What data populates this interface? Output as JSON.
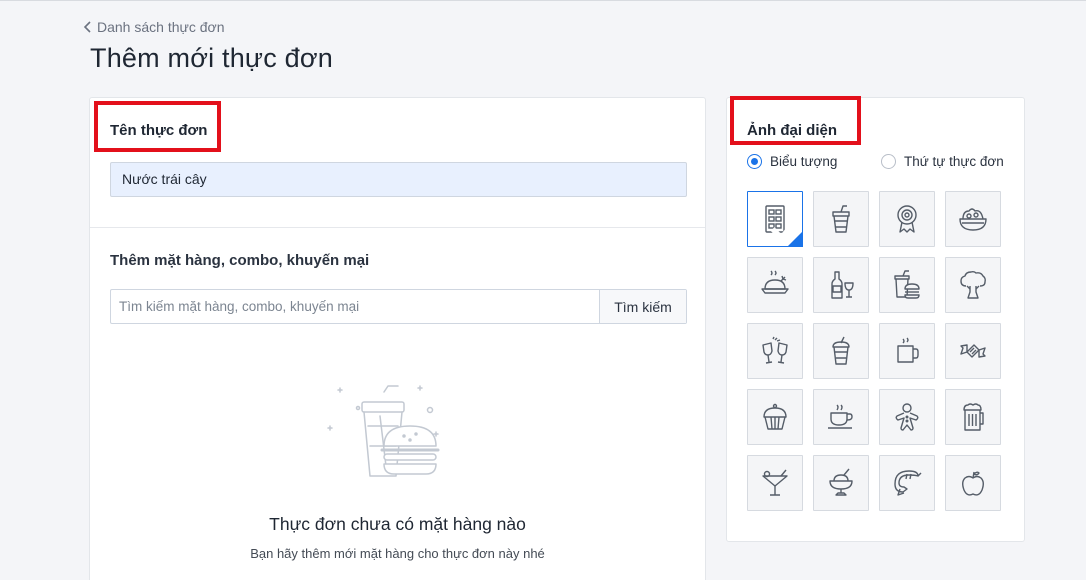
{
  "header": {
    "breadcrumb": "Danh sách thực đơn",
    "title": "Thêm mới thực đơn"
  },
  "menu_name": {
    "label": "Tên thực đơn",
    "value": "Nước trái cây"
  },
  "items": {
    "label": "Thêm mặt hàng, combo, khuyến mại",
    "search_placeholder": "Tìm kiếm mặt hàng, combo, khuyến mại",
    "search_button": "Tìm kiếm",
    "empty_title": "Thực đơn chưa có mặt hàng nào",
    "empty_subtitle": "Bạn hãy thêm mới mặt hàng cho thực đơn này nhé"
  },
  "avatar": {
    "label": "Ảnh đại diện",
    "options": [
      {
        "label": "Biểu tượng",
        "checked": true
      },
      {
        "label": "Thứ tự thực đơn",
        "checked": false
      }
    ],
    "icons": [
      "menu-grid-icon",
      "drink-cup-icon",
      "medal-icon",
      "salad-bowl-icon",
      "roast-chicken-icon",
      "wine-bottle-glass-icon",
      "fast-food-icon",
      "broccoli-icon",
      "toast-glasses-icon",
      "juice-cup-icon",
      "coffee-mug-icon",
      "candy-icon",
      "cupcake-icon",
      "tea-cup-icon",
      "gingerbread-icon",
      "beer-mug-icon",
      "cocktail-icon",
      "ice-cream-bowl-icon",
      "shrimp-icon",
      "apple-icon"
    ],
    "selected_icon": "menu-grid-icon"
  },
  "colors": {
    "accent": "#1a73e8",
    "highlight": "#e3101b"
  }
}
